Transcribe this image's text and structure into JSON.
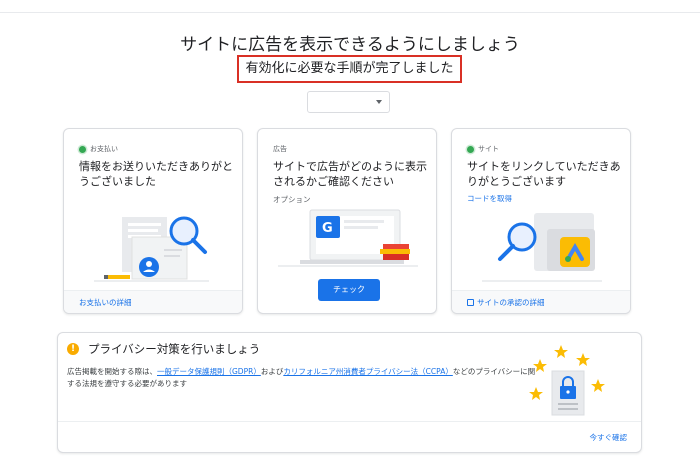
{
  "page": {
    "title": "サイトに広告を表示できるようにしましょう",
    "status_message": "有効化に必要な手順が完了しました",
    "site_selector": {
      "value": ""
    }
  },
  "cards": [
    {
      "tag": "お支払い",
      "tag_done": true,
      "headline": "情報をお送りいただきありがとうございました",
      "footer_link": "お支払いの詳細"
    },
    {
      "tag": "広告",
      "tag_done": false,
      "headline": "サイトで広告がどのように表示されるかご確認ください",
      "sub": "オプション",
      "button": "チェック"
    },
    {
      "tag": "サイト",
      "tag_done": true,
      "headline": "サイトをリンクしていただきありがとうございます",
      "action_link": "コードを取得",
      "footer_link": "サイトの承認の詳細"
    }
  ],
  "privacy": {
    "title": "プライバシー対策を行いましょう",
    "body_prefix": "広告掲載を開始する際は、",
    "gdpr_link": "一般データ保護規則（GDPR）",
    "body_mid": "および",
    "ccpa_link": "カリフォルニア州消費者プライバシー法（CCPA）",
    "body_suffix": "などのプライバシーに関する法規を遵守する必要があります",
    "action_link": "今すぐ確認"
  },
  "colors": {
    "primary": "#1a73e8",
    "success": "#34a853",
    "warning": "#f9ab00",
    "alert_border": "#d93025",
    "border": "#dadce0"
  },
  "icons": {
    "dropdown": "caret-down-icon",
    "done": "check-dot-icon",
    "warning": "exclamation-circle-icon",
    "footer_site": "external-page-icon"
  }
}
